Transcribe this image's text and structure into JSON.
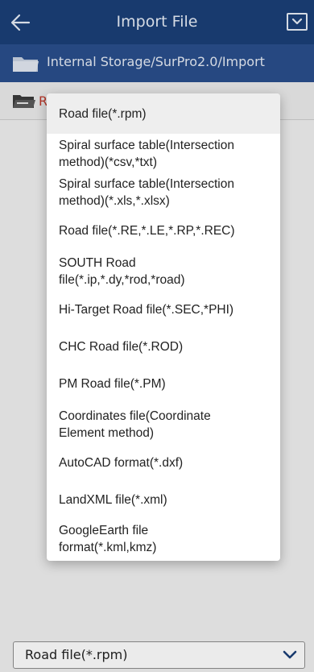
{
  "header": {
    "title": "Import File",
    "back_icon": "arrow-left-icon",
    "menu_icon": "dropdown-box-icon"
  },
  "path": {
    "text": "Internal Storage/SurPro2.0/Import",
    "icon": "folder-icon"
  },
  "list": {
    "row_label": "R",
    "row_icon": "folder-open-icon"
  },
  "menu": {
    "selected_index": 0,
    "items": [
      {
        "label": "Road file(*.rpm)"
      },
      {
        "label": "Spiral surface table(Intersection method)(*csv,*txt)"
      },
      {
        "label": "Spiral surface table(Intersection method)(*.xls,*.xlsx)"
      },
      {
        "label": "Road file(*.RE,*.LE,*.RP,*.REC)"
      },
      {
        "label": "SOUTH Road file(*.ip,*.dy,*rod,*road)"
      },
      {
        "label": "Hi-Target Road file(*.SEC,*PHI)"
      },
      {
        "label": "CHC Road file(*.ROD)"
      },
      {
        "label": "PM Road file(*.PM)"
      },
      {
        "label": "Coordinates file(Coordinate Element method)"
      },
      {
        "label": "AutoCAD format(*.dxf)"
      },
      {
        "label": "LandXML file(*.xml)"
      },
      {
        "label": "GoogleEarth file format(*.kml,kmz)"
      }
    ]
  },
  "file_type_select": {
    "value": "Road file(*.rpm)",
    "icon": "chevron-down-icon"
  },
  "colors": {
    "header_bg": "#1b3f78",
    "pathbar_bg": "#2a4f8c",
    "accent_text": "#c0392b"
  }
}
